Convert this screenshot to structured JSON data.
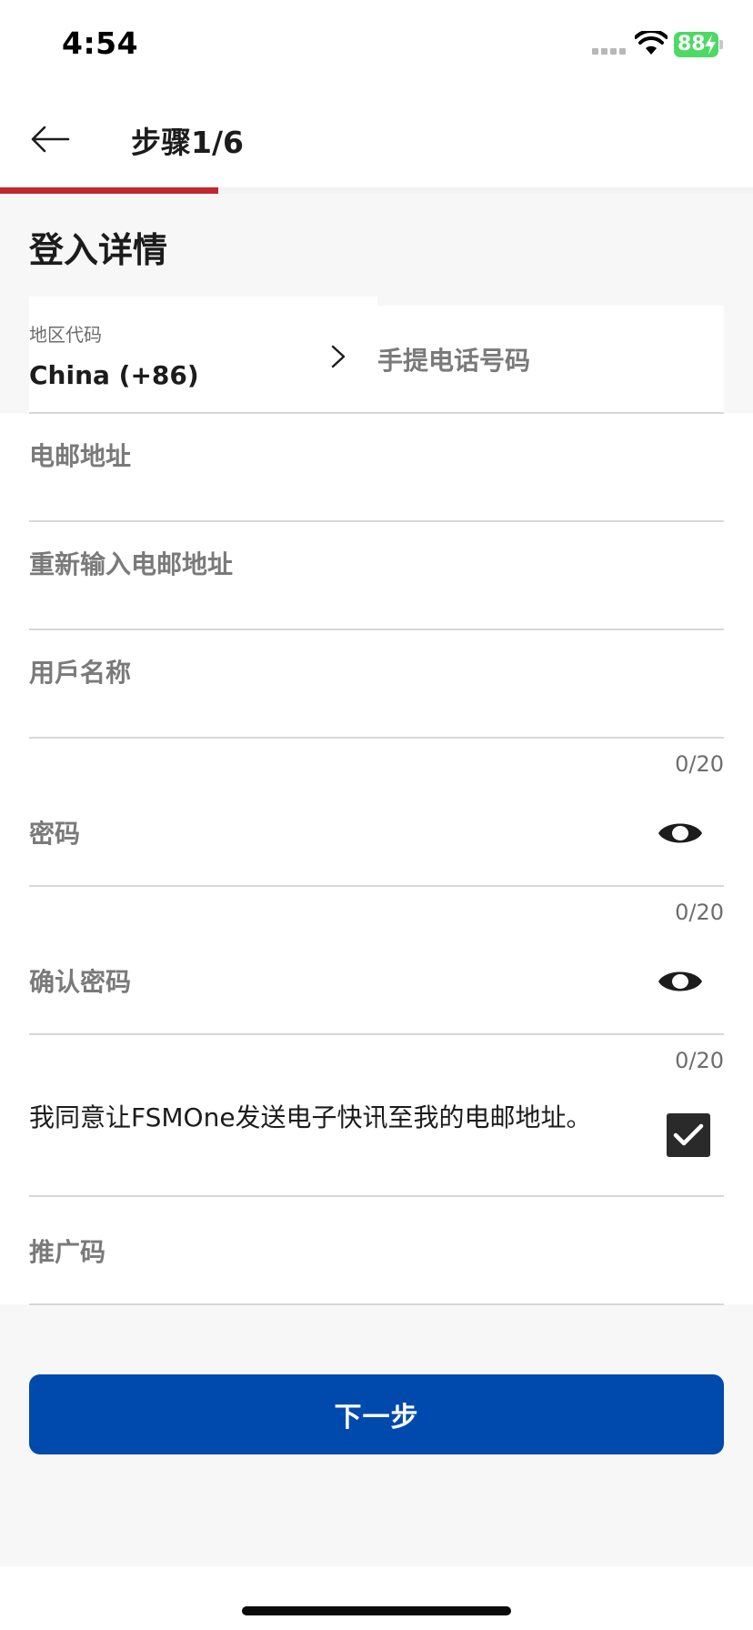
{
  "status_bar": {
    "time": "4:54",
    "battery": "88"
  },
  "header": {
    "title": "步骤1/6",
    "progress_fraction": 0.29
  },
  "section": {
    "title": "登入详情"
  },
  "form": {
    "region_label": "地区代码",
    "region_value": "China (+86)",
    "phone_placeholder": "手提电话号码",
    "email_placeholder": "电邮地址",
    "email_confirm_placeholder": "重新输入电邮地址",
    "username_placeholder": "用戶名称",
    "username_counter": "0/20",
    "password_placeholder": "密码",
    "password_counter": "0/20",
    "confirm_password_placeholder": "确认密码",
    "confirm_password_counter": "0/20",
    "consent_text": "我同意让FSMOne发送电子快讯至我的电邮地址。",
    "consent_checked": true,
    "promo_placeholder": "推广码"
  },
  "actions": {
    "next_label": "下一步"
  },
  "colors": {
    "accent": "#004aad",
    "progress": "#c0282d",
    "battery": "#4cd964"
  }
}
